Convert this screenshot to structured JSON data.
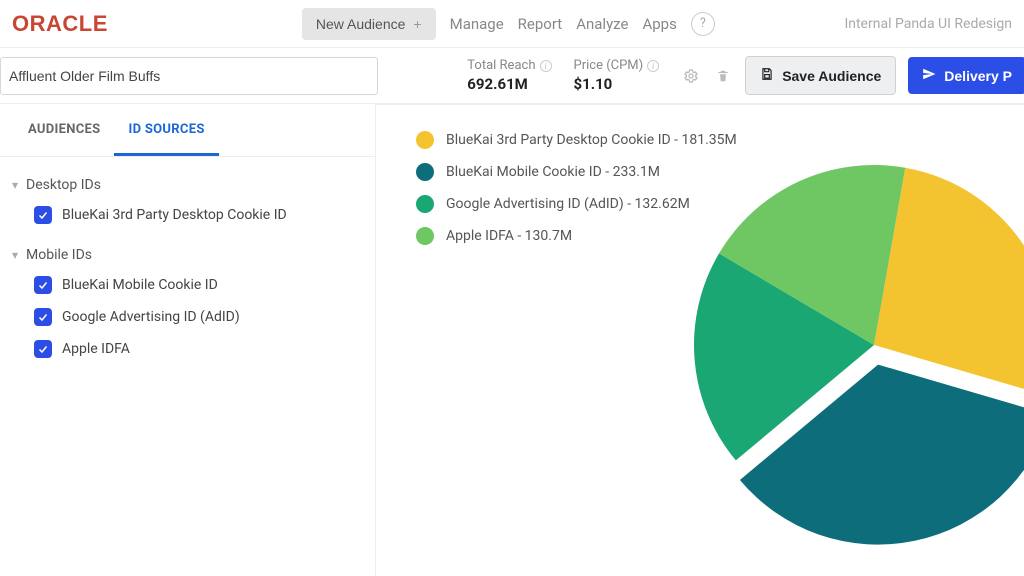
{
  "brand": "ORACLE",
  "topnav": {
    "new_audience": "New Audience",
    "manage": "Manage",
    "report": "Report",
    "analyze": "Analyze",
    "apps": "Apps",
    "help": "?",
    "project": "Internal Panda UI Redesign"
  },
  "audience_name": "Affluent Older Film Buffs",
  "metrics": {
    "reach_label": "Total Reach",
    "reach_value": "692.61M",
    "cpm_label": "Price (CPM)",
    "cpm_value": "$1.10"
  },
  "actions": {
    "save": "Save Audience",
    "delivery": "Delivery P"
  },
  "tabs": {
    "audiences": "AUDIENCES",
    "id_sources": "ID SOURCES"
  },
  "tree": {
    "desktop": {
      "label": "Desktop IDs",
      "items": [
        {
          "label": "BlueKai 3rd Party Desktop Cookie ID",
          "checked": true
        }
      ]
    },
    "mobile": {
      "label": "Mobile IDs",
      "items": [
        {
          "label": "BlueKai Mobile Cookie ID",
          "checked": true
        },
        {
          "label": "Google Advertising ID (AdID)",
          "checked": true
        },
        {
          "label": "Apple IDFA",
          "checked": true
        }
      ]
    }
  },
  "chart_data": {
    "type": "pie",
    "title": "",
    "series": [
      {
        "name": "BlueKai 3rd Party Desktop Cookie ID",
        "value": 181.35,
        "suffix": "M",
        "color": "#f4c430"
      },
      {
        "name": "BlueKai Mobile Cookie ID",
        "value": 233.1,
        "suffix": "M",
        "color": "#0e6d7a"
      },
      {
        "name": "Google Advertising ID (AdID)",
        "value": 132.62,
        "suffix": "M",
        "color": "#1aa773"
      },
      {
        "name": "Apple IDFA",
        "value": 130.7,
        "suffix": "M",
        "color": "#6fc764"
      }
    ]
  },
  "colors": {
    "accent": "#2b4ee6",
    "brand": "#c74634"
  }
}
